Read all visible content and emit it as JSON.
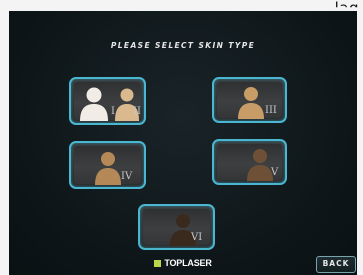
{
  "window": {
    "top_right_text": "lag"
  },
  "screen": {
    "title": "PLEASE SELECT SKIN TYPE",
    "skin_types": [
      {
        "numeral_a": "I",
        "numeral_b": "II",
        "tone_a": "#f1ece6",
        "tone_b": "#d9b98d"
      },
      {
        "numeral": "III",
        "tone": "#c79c67"
      },
      {
        "numeral": "IV",
        "tone": "#b48957"
      },
      {
        "numeral": "V",
        "tone": "#6e5036"
      },
      {
        "numeral": "VI",
        "tone": "#3a2a1d"
      }
    ],
    "brand": "TOPLASER",
    "brand_accent": "#b7d84b",
    "back_label": "BACK",
    "border_color": "#4bb6d0"
  }
}
